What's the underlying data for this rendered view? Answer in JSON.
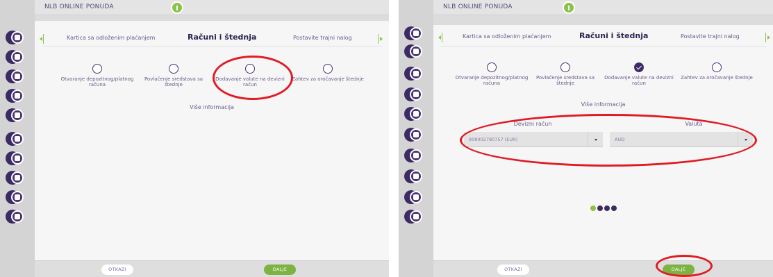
{
  "brand": {
    "accent": "#3b2a63",
    "green": "#8bc34a",
    "highlight": "#e01b24"
  },
  "rail_icons": [
    "chart-icon",
    "briefcase-icon",
    "card-icon",
    "leaf-icon",
    "atm-icon",
    "wallet-icon",
    "coins-icon",
    "location-icon",
    "currency-icon",
    "settings-icon"
  ],
  "app_title": "NLB ONLINE PONUDA",
  "tabs": {
    "prev": "Kartica sa odloženim plaćanjem",
    "active": "Računi i štednja",
    "next": "Postavite trajni nalog"
  },
  "steps": [
    {
      "label": "Otvaranje depozitnog/platnog računa"
    },
    {
      "label": "Povlačenje sredstava sa štednje"
    },
    {
      "label": "Dodavanje valute na devizni račun"
    },
    {
      "label": "Zahtev za oročavanje štednje"
    }
  ],
  "more_info": "Više informacija",
  "form": {
    "account_label": "Devizni račun",
    "account_value": "908002780757 (EUR)",
    "currency_label": "Valuta",
    "currency_value": "AUD"
  },
  "wizard": {
    "current_page": 1,
    "total_pages": 4
  },
  "buttons": {
    "cancel": "OTKAZI",
    "next": "DALJE"
  }
}
